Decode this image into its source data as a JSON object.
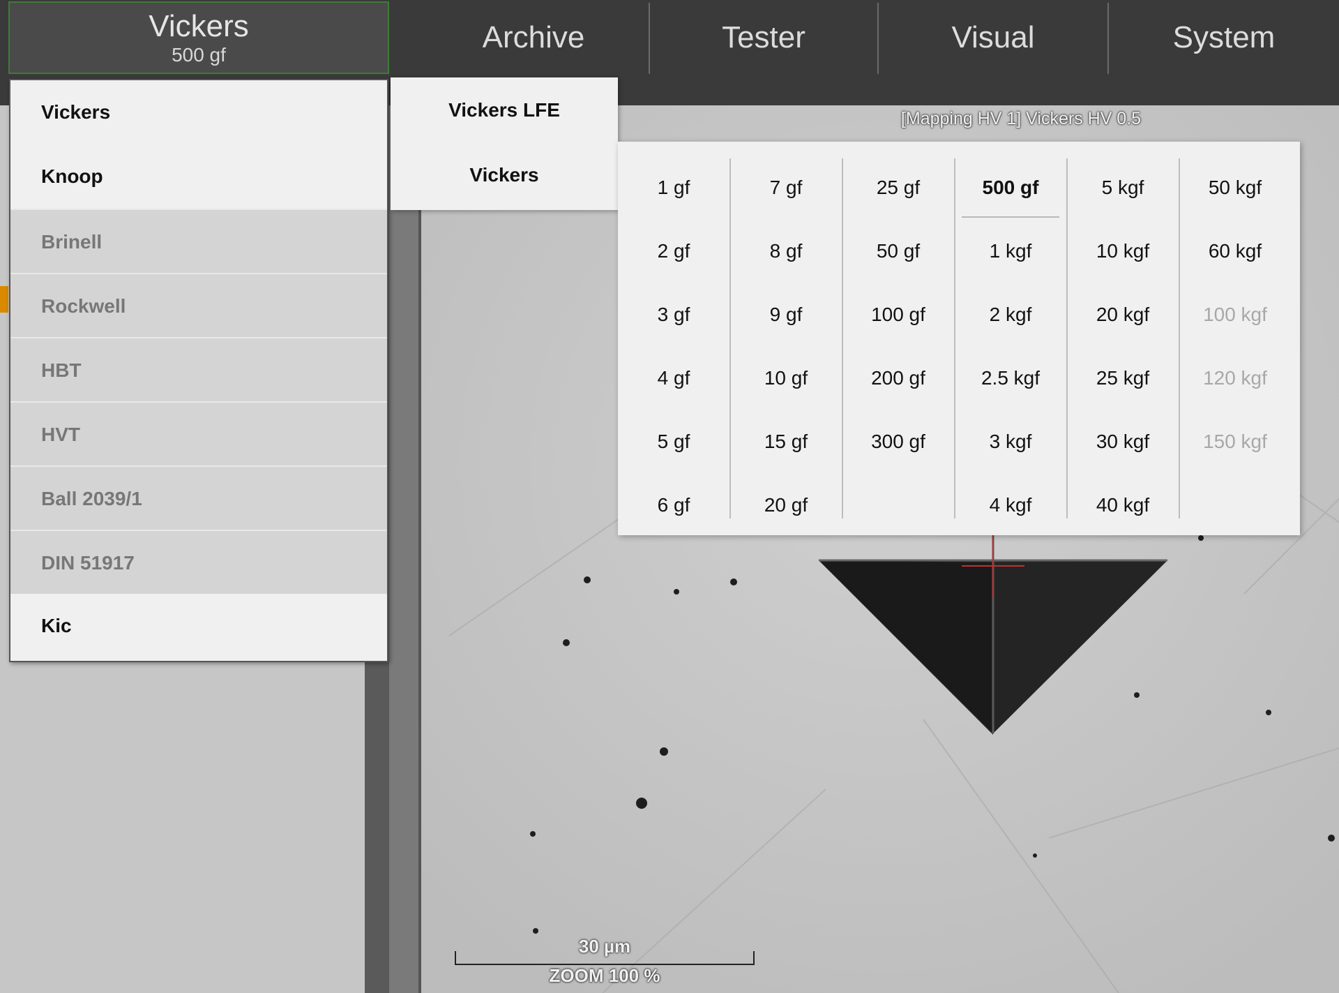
{
  "topbar": {
    "method": {
      "label": "Vickers",
      "load": "500 gf"
    },
    "nav": [
      "Archive",
      "Tester",
      "Visual",
      "System"
    ]
  },
  "view": {
    "title": "[Mapping HV 1] Vickers HV 0.5",
    "scale": "30 µm",
    "zoom": "ZOOM 100 %"
  },
  "method_menu": {
    "items": [
      {
        "label": "Vickers",
        "enabled": true
      },
      {
        "label": "Knoop",
        "enabled": true
      },
      {
        "label": "Brinell",
        "enabled": false
      },
      {
        "label": "Rockwell",
        "enabled": false
      },
      {
        "label": "HBT",
        "enabled": false
      },
      {
        "label": "HVT",
        "enabled": false
      },
      {
        "label": "Ball 2039/1",
        "enabled": false
      },
      {
        "label": "DIN 51917",
        "enabled": false
      },
      {
        "label": "Kic",
        "enabled": true
      }
    ]
  },
  "sub_menu": {
    "items": [
      "Vickers LFE",
      "Vickers"
    ]
  },
  "force_grid": {
    "selected": "500 gf",
    "columns": [
      [
        "1 gf",
        "2 gf",
        "3 gf",
        "4 gf",
        "5 gf",
        "6 gf"
      ],
      [
        "7 gf",
        "8 gf",
        "9 gf",
        "10 gf",
        "15 gf",
        "20 gf"
      ],
      [
        "25 gf",
        "50 gf",
        "100 gf",
        "200 gf",
        "300 gf"
      ],
      [
        "500 gf",
        "1 kgf",
        "2 kgf",
        "2.5 kgf",
        "3 kgf",
        "4 kgf"
      ],
      [
        "5 kgf",
        "10 kgf",
        "20 kgf",
        "25 kgf",
        "30 kgf",
        "40 kgf"
      ],
      [
        "50 kgf",
        "60 kgf",
        "100 kgf",
        "120 kgf",
        "150 kgf"
      ]
    ],
    "disabled": [
      "100 kgf",
      "120 kgf",
      "150 kgf"
    ]
  }
}
